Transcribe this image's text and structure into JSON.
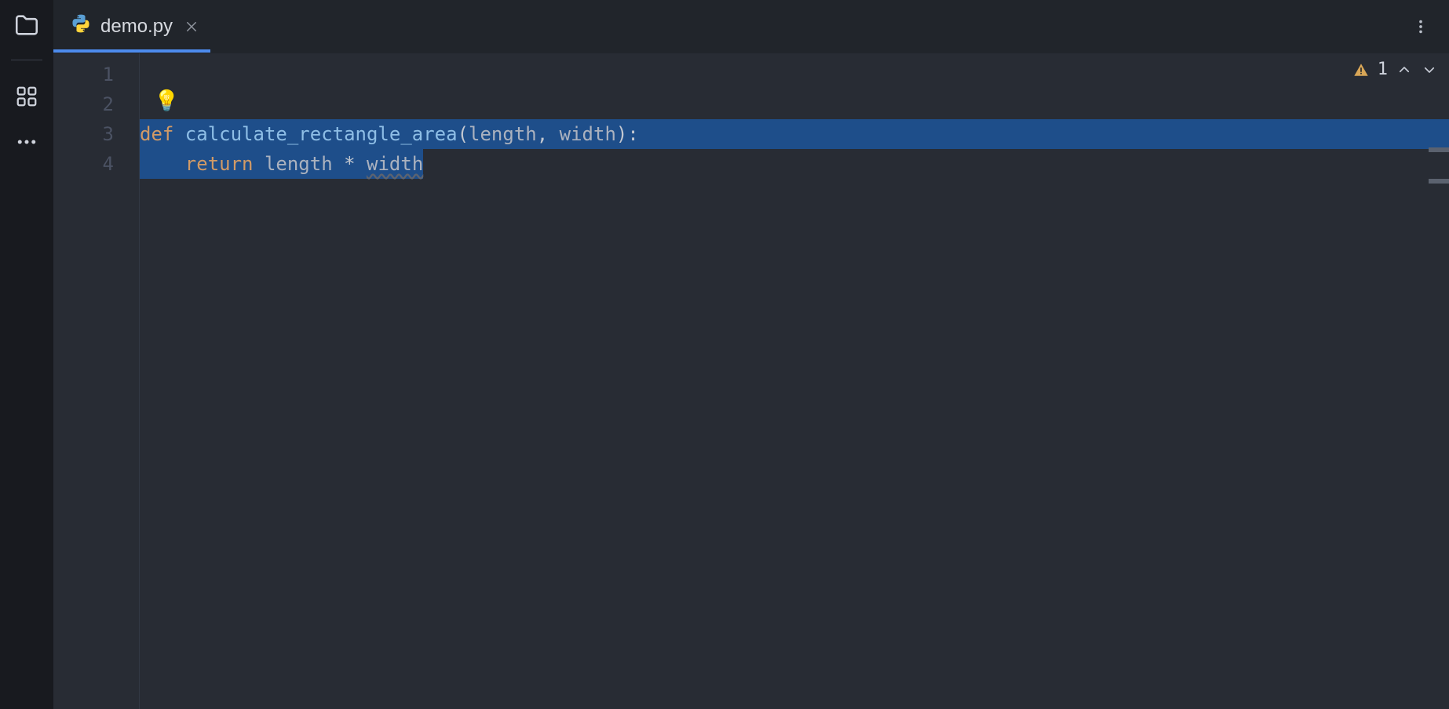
{
  "tabs": {
    "active": {
      "file_name": "demo.py",
      "file_icon": "python-icon"
    }
  },
  "activity_bar": {
    "items": [
      {
        "name": "folder-icon"
      },
      {
        "name": "grid-icon"
      },
      {
        "name": "more-icon"
      }
    ]
  },
  "lightbulb_emoji": "💡",
  "problems": {
    "warning_count": "1"
  },
  "gutter": {
    "lines": [
      "1",
      "2",
      "3",
      "4"
    ]
  },
  "code": {
    "line3": {
      "def": "def ",
      "fn": "calculate_rectangle_area",
      "open": "(",
      "p1": "length",
      "comma": ", ",
      "p2": "width",
      "close": ")",
      "colon": ":"
    },
    "line4": {
      "indent": "    ",
      "ret": "return ",
      "a": "length",
      "op": " * ",
      "b": "width"
    }
  },
  "colors": {
    "selection": "#1e4e8a",
    "tab_underline": "#4d8bed"
  }
}
